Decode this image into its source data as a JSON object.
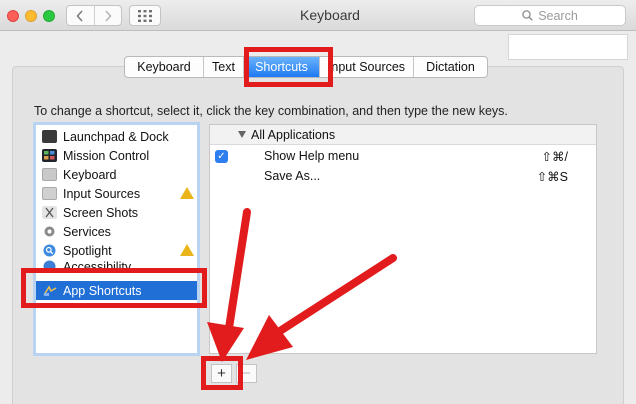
{
  "window": {
    "title": "Keyboard"
  },
  "search": {
    "placeholder": "Search"
  },
  "tabs": [
    {
      "label": "Keyboard"
    },
    {
      "label": "Text"
    },
    {
      "label": "Shortcuts",
      "selected": true
    },
    {
      "label": "Input Sources"
    },
    {
      "label": "Dictation"
    }
  ],
  "instruction": "To change a shortcut, select it, click the key combination, and then type the new keys.",
  "categories": [
    {
      "label": "Launchpad & Dock",
      "icon": "launchpad-dock-icon"
    },
    {
      "label": "Mission Control",
      "icon": "mission-control-icon"
    },
    {
      "label": "Keyboard",
      "icon": "keyboard-icon"
    },
    {
      "label": "Input Sources",
      "icon": "input-sources-icon",
      "warning": true
    },
    {
      "label": "Screen Shots",
      "icon": "screenshot-icon"
    },
    {
      "label": "Services",
      "icon": "gear-icon"
    },
    {
      "label": "Spotlight",
      "icon": "spotlight-icon",
      "warning": true
    },
    {
      "label": "Accessibility",
      "icon": "accessibility-icon"
    },
    {
      "label": "App Shortcuts",
      "icon": "app-shortcuts-icon",
      "selected": true
    }
  ],
  "shortcuts": {
    "group": "All Applications",
    "rows": [
      {
        "name": "Show Help menu",
        "keys": "⇧⌘/",
        "checked": true
      },
      {
        "name": "Save As...",
        "keys": "⇧⌘S",
        "checked": false
      }
    ]
  },
  "buttons": {
    "add": "+",
    "remove": "−"
  },
  "colors": {
    "accent": "#1f6fd7",
    "highlight": "#e21c1c",
    "warning": "#e9b51a"
  }
}
